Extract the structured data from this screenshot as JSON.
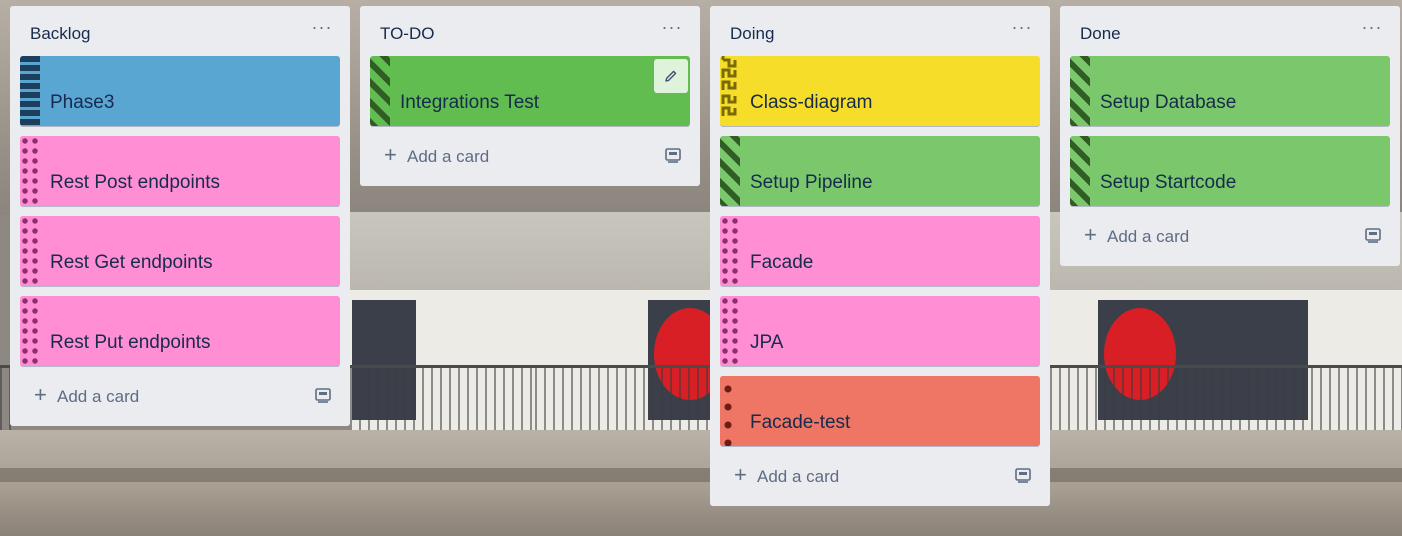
{
  "colors": {
    "list_bg": "#ebecf0",
    "text": "#172b4d",
    "muted": "#5e6c84",
    "label_blue": "#5aa6d3",
    "label_pink": "#ff8ed4",
    "label_green": "#7bc86c",
    "label_green_dark": "#61bd4f",
    "label_yellow": "#f5dd29",
    "label_red": "#ef7564"
  },
  "board": {
    "lists": [
      {
        "title": "Backlog",
        "menu": "···",
        "cards": [
          {
            "text": "Phase3",
            "color": "#5aa6d3",
            "pattern": "bars"
          },
          {
            "text": "Rest Post endpoints",
            "color": "#ff8ed4",
            "pattern": "dots"
          },
          {
            "text": "Rest Get endpoints",
            "color": "#ff8ed4",
            "pattern": "dots"
          },
          {
            "text": "Rest Put endpoints",
            "color": "#ff8ed4",
            "pattern": "dots"
          }
        ],
        "add_label": "Add a card"
      },
      {
        "title": "TO-DO",
        "menu": "···",
        "cards": [
          {
            "text": "Integrations Test",
            "color": "#61bd4f",
            "pattern": "diagonal",
            "hover_edit": true
          }
        ],
        "add_label": "Add a card"
      },
      {
        "title": "Doing",
        "menu": "···",
        "cards": [
          {
            "text": "Class-diagram",
            "color": "#f5dd29",
            "pattern": "zigzag"
          },
          {
            "text": "Setup Pipeline",
            "color": "#7bc86c",
            "pattern": "diagonal"
          },
          {
            "text": "Facade",
            "color": "#ff8ed4",
            "pattern": "dots"
          },
          {
            "text": "JPA",
            "color": "#ff8ed4",
            "pattern": "dots"
          },
          {
            "text": "Facade-test",
            "color": "#ef7564",
            "pattern": "big-dots"
          }
        ],
        "add_label": "Add a card"
      },
      {
        "title": "Done",
        "menu": "···",
        "cards": [
          {
            "text": "Setup Database",
            "color": "#7bc86c",
            "pattern": "diagonal"
          },
          {
            "text": "Setup Startcode",
            "color": "#7bc86c",
            "pattern": "diagonal"
          }
        ],
        "add_label": "Add a card"
      }
    ]
  },
  "icons": {
    "list_menu": "more-horizontal-icon",
    "add": "plus-icon",
    "template": "card-template-icon",
    "edit": "pencil-icon"
  }
}
